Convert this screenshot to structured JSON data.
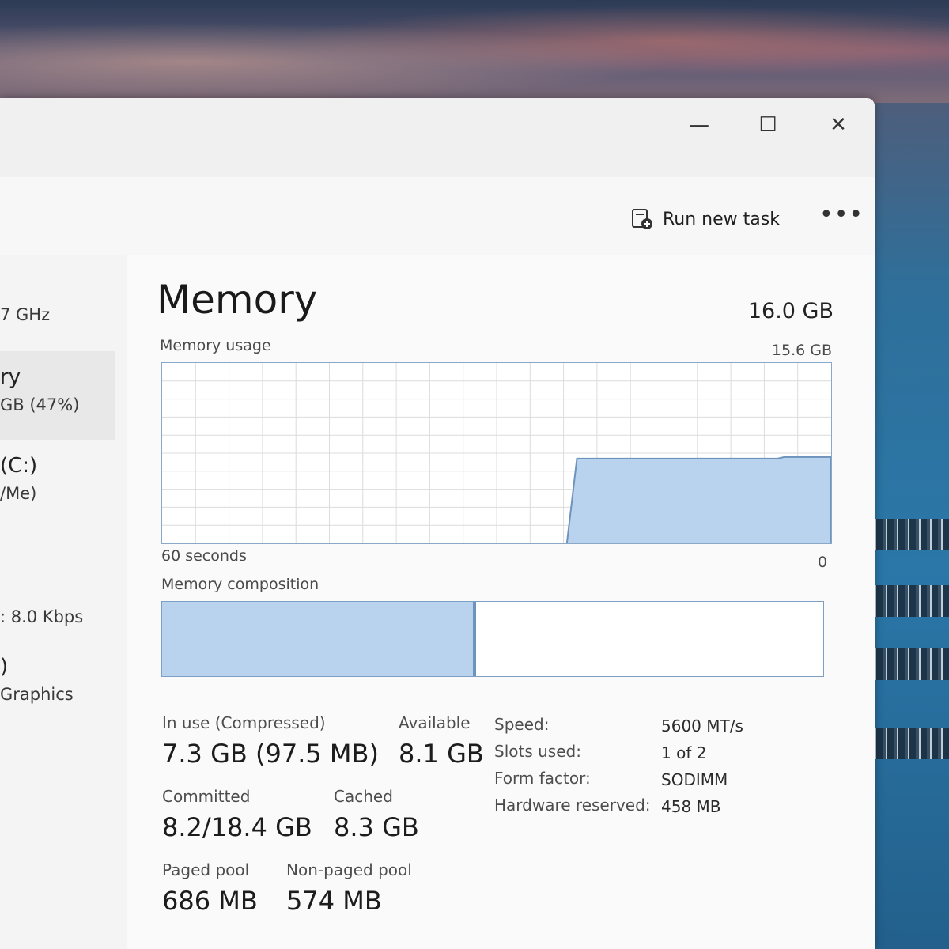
{
  "window": {
    "controls": {
      "minimize": "—",
      "maximize": "☐",
      "close": "✕"
    }
  },
  "toolbar": {
    "run_new_task": "Run new task",
    "more": "•••"
  },
  "sidebar": {
    "items": [
      {
        "line1": "7 GHz"
      },
      {
        "line1": "ry",
        "line2": "GB (47%)"
      },
      {
        "line1": "(C:)",
        "line2": "/Me)"
      },
      {
        "line1": ": 8.0 Kbps"
      },
      {
        "line1": ")",
        "line2": "Graphics"
      }
    ]
  },
  "memory": {
    "title": "Memory",
    "total": "16.0 GB",
    "usage_label": "Memory usage",
    "usage_max": "15.6 GB",
    "time_label": "60 seconds",
    "zero_label": "0",
    "composition_label": "Memory composition",
    "usage_fraction": 0.47,
    "in_use_fraction": 0.47
  },
  "stats": {
    "in_use_label": "In use (Compressed)",
    "in_use_value": "7.3 GB (97.5 MB)",
    "available_label": "Available",
    "available_value": "8.1 GB",
    "committed_label": "Committed",
    "committed_value": "8.2/18.4 GB",
    "cached_label": "Cached",
    "cached_value": "8.3 GB",
    "paged_label": "Paged pool",
    "paged_value": "686 MB",
    "nonpaged_label": "Non-paged pool",
    "nonpaged_value": "574 MB"
  },
  "specs": [
    {
      "label": "Speed:",
      "value": "5600 MT/s"
    },
    {
      "label": "Slots used:",
      "value": "1 of 2"
    },
    {
      "label": "Form factor:",
      "value": "SODIMM"
    },
    {
      "label": "Hardware reserved:",
      "value": "458 MB"
    }
  ],
  "colors": {
    "graph_fill": "#b9d3ef",
    "graph_line": "#6e93bd",
    "grid": "#dcdcdc"
  }
}
